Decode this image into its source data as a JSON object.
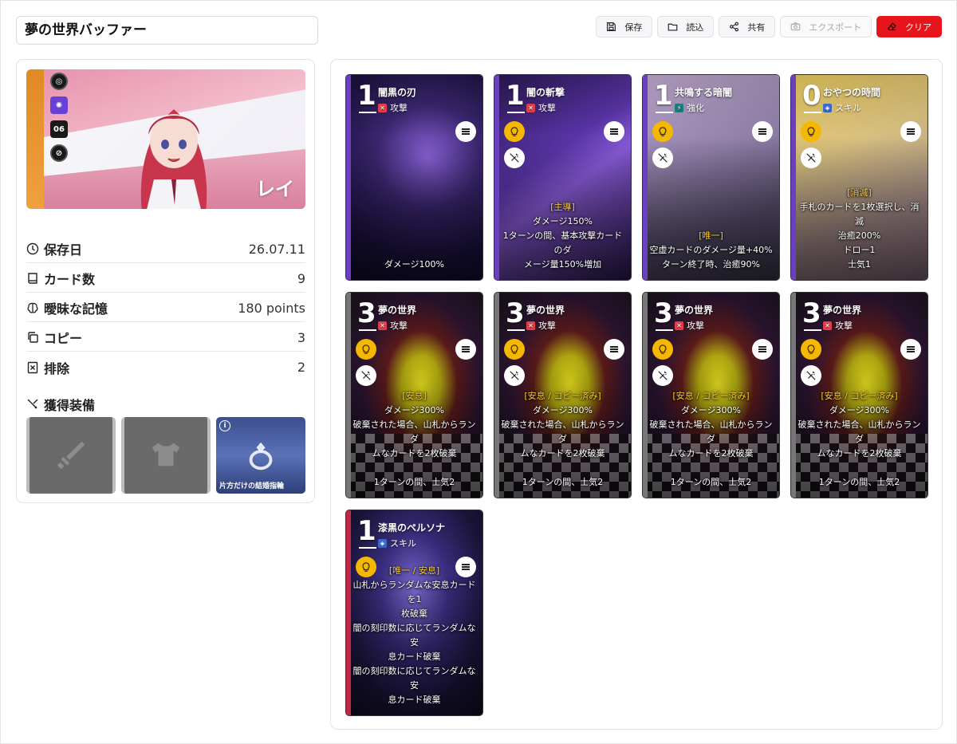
{
  "header": {
    "deck_name": "夢の世界バッファー",
    "buttons": [
      {
        "label": "保存",
        "icon": "save-icon"
      },
      {
        "label": "読込",
        "icon": "folder-icon"
      },
      {
        "label": "共有",
        "icon": "share-icon"
      },
      {
        "label": "エクスポート",
        "icon": "camera-icon",
        "disabled": true
      },
      {
        "label": "クリア",
        "icon": "eraser-icon",
        "danger": true
      }
    ]
  },
  "character": {
    "name": "レイ",
    "badge": "06"
  },
  "stats": [
    {
      "label": "保存日",
      "value": "26.07.11",
      "icon": "clock-icon"
    },
    {
      "label": "カード数",
      "value": "9",
      "icon": "book-icon"
    },
    {
      "label": "曖昧な記憶",
      "value": "180 points",
      "icon": "brain-icon"
    },
    {
      "label": "コピー",
      "value": "3",
      "icon": "copy-icon"
    },
    {
      "label": "排除",
      "value": "2",
      "icon": "remove-icon"
    }
  ],
  "equipment": {
    "title": "獲得装備",
    "items": [
      {
        "name": "",
        "icon": "sword-icon",
        "filled": false
      },
      {
        "name": "",
        "icon": "armor-icon",
        "filled": false
      },
      {
        "name": "片方だけの結婚指輪",
        "icon": "ring-icon",
        "filled": true
      }
    ]
  },
  "cards": [
    {
      "cost": "1",
      "name": "闇黒の刃",
      "type": "攻撃",
      "type_kind": "atk",
      "art": "art-dark1",
      "stripe": "#6a3fc0",
      "bulb": false,
      "hide": false,
      "tag": "",
      "lines": [
        "ダメージ100%"
      ]
    },
    {
      "cost": "1",
      "name": "闇の斬撃",
      "type": "攻撃",
      "type_kind": "atk",
      "art": "art-dark2",
      "stripe": "#6a3fc0",
      "bulb": true,
      "hide": true,
      "tag": "[主導]",
      "lines": [
        "ダメージ150%",
        "1ターンの間、基本攻撃カードのダ",
        "メージ量150%増加"
      ]
    },
    {
      "cost": "1",
      "name": "共鳴する暗闇",
      "type": "強化",
      "type_kind": "buff",
      "art": "art-dark3",
      "stripe": "#6a3fc0",
      "bulb": true,
      "hide": true,
      "tag": "[唯一]",
      "lines": [
        "空虚カードのダメージ量+40%",
        "ターン終了時、治癒90%"
      ]
    },
    {
      "cost": "0",
      "name": "おやつの時間",
      "type": "スキル",
      "type_kind": "skill",
      "art": "art-snack",
      "stripe": "#6a3fc0",
      "bulb": true,
      "hide": true,
      "tag": "[消滅]",
      "lines": [
        "手札のカードを1枚選択し、消滅",
        "治癒200%",
        "ドロー1",
        "士気1"
      ]
    },
    {
      "cost": "3",
      "name": "夢の世界",
      "type": "攻撃",
      "type_kind": "atk",
      "art": "art-dream",
      "stripe": "#777",
      "bulb": true,
      "hide": true,
      "tag": "[安息]",
      "lines": [
        "ダメージ300%",
        "破棄された場合、山札からランダ",
        "ムなカードを2枚破棄",
        "",
        "1ターンの間、士気2"
      ]
    },
    {
      "cost": "3",
      "name": "夢の世界",
      "type": "攻撃",
      "type_kind": "atk",
      "art": "art-dream",
      "stripe": "#777",
      "bulb": true,
      "hide": true,
      "tag": "[安息 / コピー済み]",
      "lines": [
        "ダメージ300%",
        "破棄された場合、山札からランダ",
        "ムなカードを2枚破棄",
        "",
        "1ターンの間、士気2"
      ]
    },
    {
      "cost": "3",
      "name": "夢の世界",
      "type": "攻撃",
      "type_kind": "atk",
      "art": "art-dream",
      "stripe": "#777",
      "bulb": true,
      "hide": true,
      "tag": "[安息 / コピー済み]",
      "lines": [
        "ダメージ300%",
        "破棄された場合、山札からランダ",
        "ムなカードを2枚破棄",
        "",
        "1ターンの間、士気2"
      ]
    },
    {
      "cost": "3",
      "name": "夢の世界",
      "type": "攻撃",
      "type_kind": "atk",
      "art": "art-dream",
      "stripe": "#777",
      "bulb": true,
      "hide": true,
      "tag": "[安息 / コピー済み]",
      "lines": [
        "ダメージ300%",
        "破棄された場合、山札からランダ",
        "ムなカードを2枚破棄",
        "",
        "1ターンの間、士気2"
      ]
    },
    {
      "cost": "1",
      "name": "漆黒のペルソナ",
      "type": "スキル",
      "type_kind": "skill",
      "art": "art-mask",
      "stripe": "#c02848",
      "bulb": true,
      "hide": false,
      "tag": "[唯一 / 安息]",
      "lines": [
        "山札からランダムな安息カードを1",
        "枚破棄",
        "闇の刻印数に応じてランダムな安",
        "息カード破棄",
        "闇の刻印数に応じてランダムな安",
        "息カード破棄"
      ]
    }
  ]
}
